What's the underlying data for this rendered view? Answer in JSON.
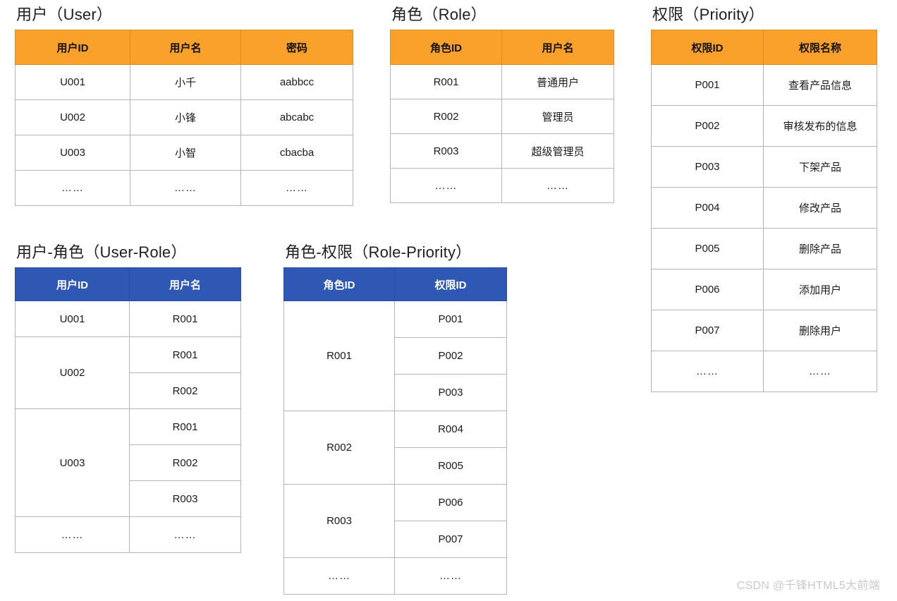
{
  "colors": {
    "header_orange": "#F9A12A",
    "header_blue": "#2F58B5",
    "border": "#b5b5b5",
    "text": "#1a1a1a",
    "watermark": "#c9c9c9",
    "background": "#ffffff"
  },
  "watermark": {
    "text": "CSDN @千锋HTML5大前端"
  },
  "tables": {
    "user": {
      "title": "用户（User）",
      "header_style": "orange",
      "columns": [
        "用户ID",
        "用户名",
        "密码"
      ],
      "rows": [
        [
          "U001",
          "小千",
          "aabbcc"
        ],
        [
          "U002",
          "小锋",
          "abcabc"
        ],
        [
          "U003",
          "小智",
          "cbacba"
        ],
        [
          "……",
          "……",
          "……"
        ]
      ]
    },
    "role": {
      "title": "角色（Role）",
      "header_style": "orange",
      "columns": [
        "角色ID",
        "用户名"
      ],
      "rows": [
        [
          "R001",
          "普通用户"
        ],
        [
          "R002",
          "管理员"
        ],
        [
          "R003",
          "超级管理员"
        ],
        [
          "……",
          "……"
        ]
      ]
    },
    "priority": {
      "title": "权限（Priority）",
      "header_style": "orange",
      "columns": [
        "权限ID",
        "权限名称"
      ],
      "rows": [
        [
          "P001",
          "查看产品信息"
        ],
        [
          "P002",
          "审核发布的信息"
        ],
        [
          "P003",
          "下架产品"
        ],
        [
          "P004",
          "修改产品"
        ],
        [
          "P005",
          "删除产品"
        ],
        [
          "P006",
          "添加用户"
        ],
        [
          "P007",
          "删除用户"
        ],
        [
          "……",
          "……"
        ]
      ]
    },
    "user_role": {
      "title": "用户-角色（User-Role）",
      "header_style": "blue",
      "columns": [
        "用户ID",
        "用户名"
      ],
      "groups": [
        {
          "key": "U001",
          "values": [
            "R001"
          ]
        },
        {
          "key": "U002",
          "values": [
            "R001",
            "R002"
          ]
        },
        {
          "key": "U003",
          "values": [
            "R001",
            "R002",
            "R003"
          ]
        },
        {
          "key": "……",
          "values": [
            "……"
          ]
        }
      ]
    },
    "role_priority": {
      "title": "角色-权限（Role-Priority）",
      "header_style": "blue",
      "columns": [
        "角色ID",
        "权限ID"
      ],
      "groups": [
        {
          "key": "R001",
          "values": [
            "P001",
            "P002",
            "P003"
          ]
        },
        {
          "key": "R002",
          "values": [
            "R004",
            "R005"
          ]
        },
        {
          "key": "R003",
          "values": [
            "P006",
            "P007"
          ]
        },
        {
          "key": "……",
          "values": [
            "……"
          ]
        }
      ]
    }
  }
}
